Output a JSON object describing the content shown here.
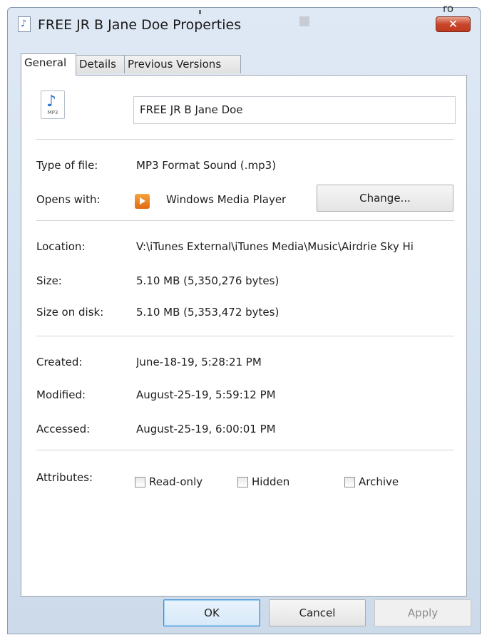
{
  "window": {
    "title": "FREE JR B Jane Doe Properties",
    "close_label": "✕",
    "ghost_text": "ro"
  },
  "tabs": [
    {
      "label": "General",
      "active": true
    },
    {
      "label": "Details",
      "active": false
    },
    {
      "label": "Previous Versions",
      "active": false
    }
  ],
  "file": {
    "icon": "mp3-file-icon",
    "icon_tag": "MP3",
    "name": "FREE JR B Jane Doe"
  },
  "properties": {
    "type_label": "Type of file:",
    "type_value": "MP3 Format Sound (.mp3)",
    "opens_label": "Opens with:",
    "opens_value": "Windows Media Player",
    "change_button": "Change...",
    "location_label": "Location:",
    "location_value": "V:\\iTunes External\\iTunes Media\\Music\\Airdrie Sky Hi",
    "size_label": "Size:",
    "size_value": "5.10 MB (5,350,276 bytes)",
    "size_disk_label": "Size on disk:",
    "size_disk_value": "5.10 MB (5,353,472 bytes)",
    "created_label": "Created:",
    "created_value": "June-18-19, 5:28:21 PM",
    "modified_label": "Modified:",
    "modified_value": "August-25-19, 5:59:12 PM",
    "accessed_label": "Accessed:",
    "accessed_value": "August-25-19, 6:00:01 PM",
    "attributes_label": "Attributes:",
    "attributes": [
      {
        "label": "Read-only",
        "checked": false
      },
      {
        "label": "Hidden",
        "checked": false
      },
      {
        "label": "Archive",
        "checked": false
      }
    ]
  },
  "buttons": {
    "ok": "OK",
    "cancel": "Cancel",
    "apply": "Apply"
  }
}
